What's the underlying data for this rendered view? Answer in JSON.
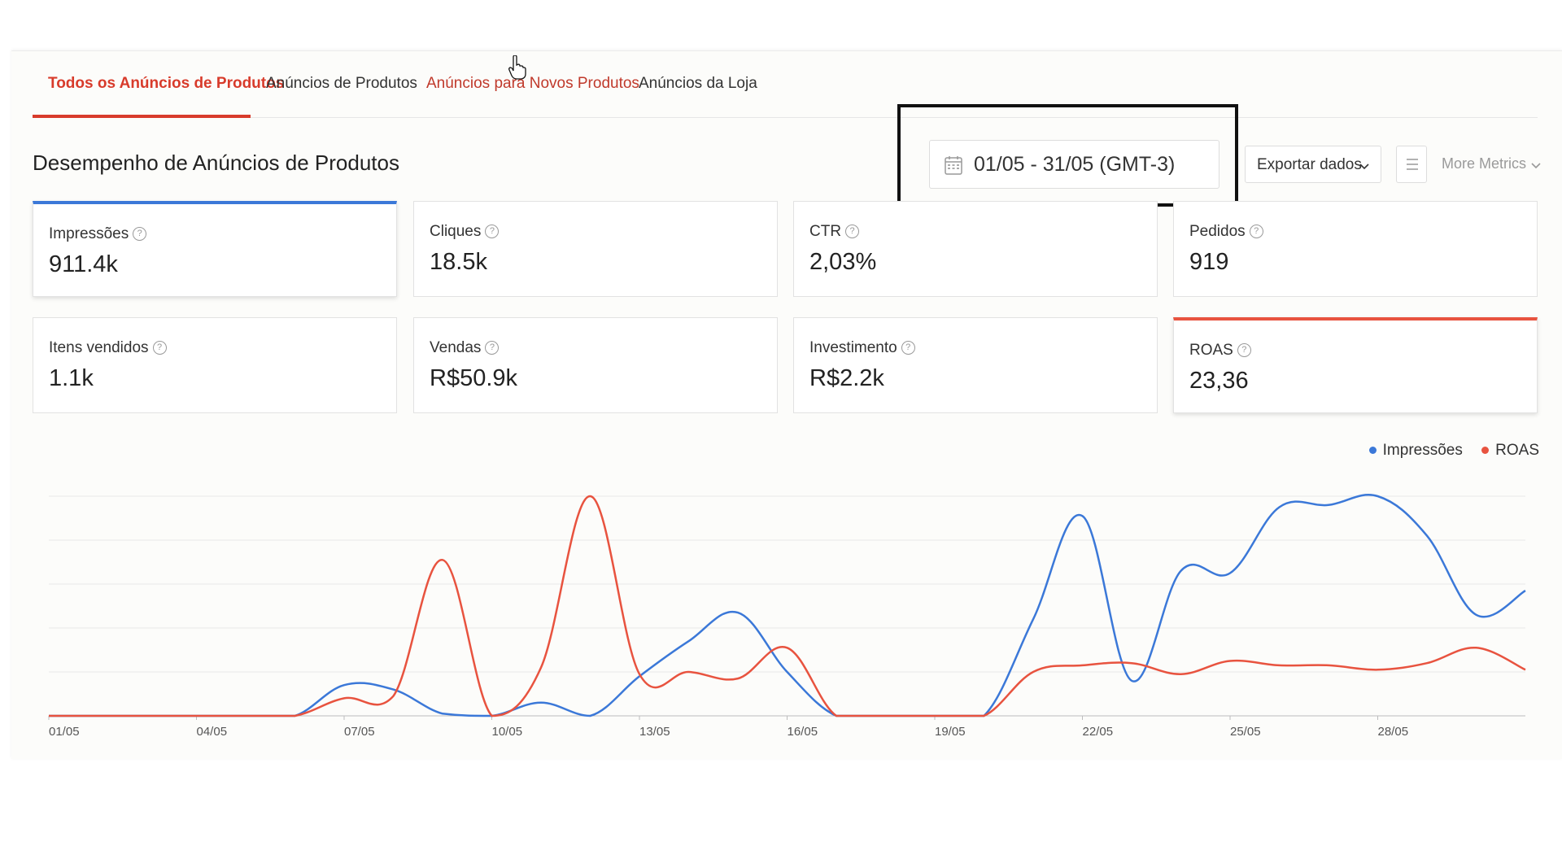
{
  "tabs": [
    {
      "label": "Todos os Anúncios de Produtos",
      "active": true
    },
    {
      "label": "Anúncios de Produtos",
      "active": false
    },
    {
      "label": "Anúncios para Novos Produtos",
      "active": false
    },
    {
      "label": "Anúncios da Loja",
      "active": false
    }
  ],
  "section_title": "Desempenho de Anúncios de Produtos",
  "date_range": "01/05 - 31/05 (GMT-3)",
  "export_label": "Exportar dados",
  "more_metrics_label": "More Metrics",
  "metrics": [
    {
      "label": "Impressões",
      "value": "911.4k",
      "selected": "blue"
    },
    {
      "label": "Cliques",
      "value": "18.5k"
    },
    {
      "label": "CTR",
      "value": "2,03%"
    },
    {
      "label": "Pedidos",
      "value": "919"
    },
    {
      "label": "Itens vendidos",
      "value": "1.1k"
    },
    {
      "label": "Vendas",
      "value": "R$50.9k"
    },
    {
      "label": "Investimento",
      "value": "R$2.2k"
    },
    {
      "label": "ROAS",
      "value": "23,36",
      "selected": "red"
    }
  ],
  "colors": {
    "accent": "#d83b2b",
    "impressions": "#3b78d8",
    "roas": "#e8533f"
  },
  "chart_data": {
    "type": "line",
    "x_tick_labels": [
      "01/05",
      "04/05",
      "07/05",
      "10/05",
      "13/05",
      "16/05",
      "19/05",
      "22/05",
      "25/05",
      "28/05"
    ],
    "x": [
      "01/05",
      "02/05",
      "03/05",
      "04/05",
      "05/05",
      "06/05",
      "07/05",
      "08/05",
      "09/05",
      "10/05",
      "11/05",
      "12/05",
      "13/05",
      "14/05",
      "15/05",
      "16/05",
      "17/05",
      "18/05",
      "19/05",
      "20/05",
      "21/05",
      "22/05",
      "23/05",
      "24/05",
      "25/05",
      "26/05",
      "27/05",
      "28/05",
      "29/05",
      "30/05",
      "31/05"
    ],
    "series": [
      {
        "name": "Impressões",
        "color": "#3b78d8",
        "values": [
          0,
          0,
          0,
          0,
          0,
          0,
          14,
          12,
          1,
          0,
          6,
          0,
          18,
          34,
          47,
          20,
          0,
          0,
          0,
          0,
          44,
          91,
          16,
          66,
          65,
          95,
          96,
          100,
          82,
          46,
          57
        ]
      },
      {
        "name": "ROAS",
        "color": "#e8533f",
        "values": [
          0,
          0,
          0,
          0,
          0,
          0,
          8,
          9,
          71,
          0,
          22,
          100,
          19,
          20,
          17,
          31,
          0,
          0,
          0,
          0,
          20,
          23,
          24,
          19,
          25,
          23,
          23,
          21,
          24,
          31,
          21
        ]
      }
    ],
    "ylim": [
      0,
      100
    ],
    "grid": true,
    "legend": "top-right"
  }
}
